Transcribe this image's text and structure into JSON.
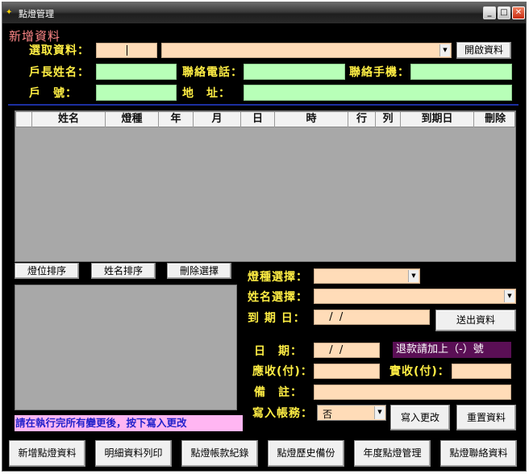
{
  "window": {
    "title": "點燈管理"
  },
  "form": {
    "section_title": "新增資料",
    "select_label": "選取資料：",
    "open_button": "開啟資料",
    "head_name_label": "戶長姓名：",
    "phone_label": "聯絡電話：",
    "mobile_label": "聯絡手機：",
    "household_label": "戶　號：",
    "address_label": "地　址："
  },
  "table": {
    "columns": [
      "姓名",
      "燈種",
      "年",
      "月",
      "日",
      "時",
      "行",
      "列",
      "到期日",
      "刪除"
    ]
  },
  "sort": {
    "lamp_sort": "燈位排序",
    "name_sort": "姓名排序",
    "delete_selected": "刪除選擇"
  },
  "entry": {
    "lamp_type_label": "燈種選擇：",
    "name_select_label": "姓名選擇：",
    "expiry_label": "到 期 日：",
    "expiry_value": "  /  /",
    "send_button": "送出資料",
    "date_label": "日　期：",
    "date_value": "  /  /",
    "refund_note": "退款請加上（-）號",
    "receivable_label": "應收(付)：",
    "received_label": "實收(付)：",
    "remark_label": "備　註：",
    "write_account_label": "寫入帳務：",
    "write_account_value": "否",
    "write_button": "寫入更改",
    "reset_button": "重置資料",
    "notice": "請在執行完所有變更後，按下寫入更改"
  },
  "bottom_buttons": [
    "新增點燈資料",
    "明細資料列印",
    "點燈帳款紀錄",
    "點燈歷史備份",
    "年度點燈管理",
    "點燈聯絡資料"
  ]
}
